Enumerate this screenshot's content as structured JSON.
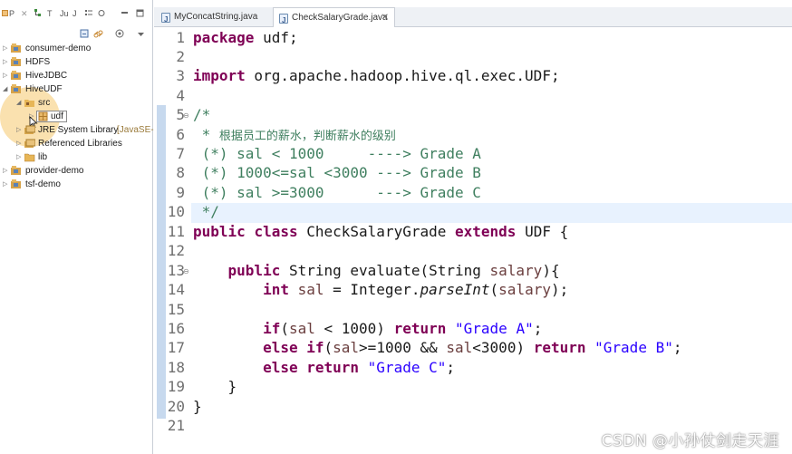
{
  "left_panel": {
    "tabs": [
      {
        "label": "P",
        "icon": "package-explorer-icon"
      },
      {
        "label": "T",
        "icon": "type-hierarchy-icon"
      },
      {
        "label": "Ju",
        "icon": "junit-icon"
      },
      {
        "label": "J",
        "icon": "javadoc-icon"
      }
    ],
    "tree": [
      {
        "label": "consumer-demo",
        "icon": "project-icon",
        "expanded": false
      },
      {
        "label": "HDFS",
        "icon": "project-icon",
        "expanded": false
      },
      {
        "label": "HiveJDBC",
        "icon": "project-icon",
        "expanded": false
      },
      {
        "label": "HiveUDF",
        "icon": "project-icon",
        "expanded": true
      },
      {
        "label": "src",
        "icon": "source-folder-icon",
        "expanded": true
      },
      {
        "label": "udf",
        "icon": "package-icon",
        "expanded": false,
        "selected": true
      },
      {
        "label": "JRE System Library",
        "decoration": "[JavaSE-",
        "icon": "library-icon",
        "expanded": false
      },
      {
        "label": "Referenced Libraries",
        "icon": "library-icon",
        "expanded": false
      },
      {
        "label": "lib",
        "icon": "folder-icon",
        "expanded": false
      },
      {
        "label": "provider-demo",
        "icon": "project-icon",
        "expanded": false
      },
      {
        "label": "tsf-demo",
        "icon": "project-icon",
        "expanded": false
      }
    ]
  },
  "editor": {
    "tabs": [
      {
        "label": "MyConcatString.java",
        "active": false
      },
      {
        "label": "CheckSalaryGrade.java",
        "active": true
      }
    ],
    "line_numbers": [
      "1",
      "2",
      "3",
      "4",
      "5",
      "6",
      "7",
      "8",
      "9",
      "10",
      "11",
      "12",
      "13",
      "14",
      "15",
      "16",
      "17",
      "18",
      "19",
      "20",
      "21"
    ],
    "code": {
      "l1_kw": "package",
      "l1_rest": " udf;",
      "l3_kw": "import",
      "l3_rest": " org.apache.hadoop.hive.ql.exec.UDF;",
      "l5": "/*",
      "l6_star": " * ",
      "l6_text": "根据员工的薪水，判断薪水的级别",
      "l7": " (*) sal < 1000     ----> Grade A",
      "l8": " (*) 1000<=sal <3000 ---> Grade B",
      "l9": " (*) sal >=3000      ---> Grade C",
      "l10": " */",
      "l11_kw1": "public",
      "l11_kw2": "class",
      "l11_name": " CheckSalaryGrade ",
      "l11_kw3": "extends",
      "l11_rest": " UDF {",
      "l13_kw": "public",
      "l13_rest_a": " String evaluate(String ",
      "l13_param": "salary",
      "l13_rest_b": "){",
      "l14_kw": "int",
      "l14_var": " sal",
      "l14_a": " = Integer.",
      "l14_method": "parseInt",
      "l14_b": "(",
      "l14_param": "salary",
      "l14_c": ");",
      "l16_kw1": "if",
      "l16_a": "(",
      "l16_var": "sal",
      "l16_b": " < 1000) ",
      "l16_kw2": "return",
      "l16_str": " \"Grade A\"",
      "l16_c": ";",
      "l17_kw1": "else",
      "l17_kw2": " if",
      "l17_a": "(",
      "l17_var1": "sal",
      "l17_b": ">=1000 && ",
      "l17_var2": "sal",
      "l17_c": "<3000) ",
      "l17_kw3": "return",
      "l17_str": " \"Grade B\"",
      "l17_d": ";",
      "l18_kw1": "else",
      "l18_kw2": " return",
      "l18_str": " \"Grade C\"",
      "l18_a": ";",
      "l19": "    }",
      "l20": "}"
    }
  },
  "watermark": "CSDN @小孙仗剑走天涯",
  "colors": {
    "keyword": "#7f0055",
    "comment": "#3f7f5f",
    "string": "#2a00ff",
    "local_var": "#6a3e3e",
    "current_line": "#e8f2fe",
    "cursor_highlight": "#f5c86e"
  }
}
